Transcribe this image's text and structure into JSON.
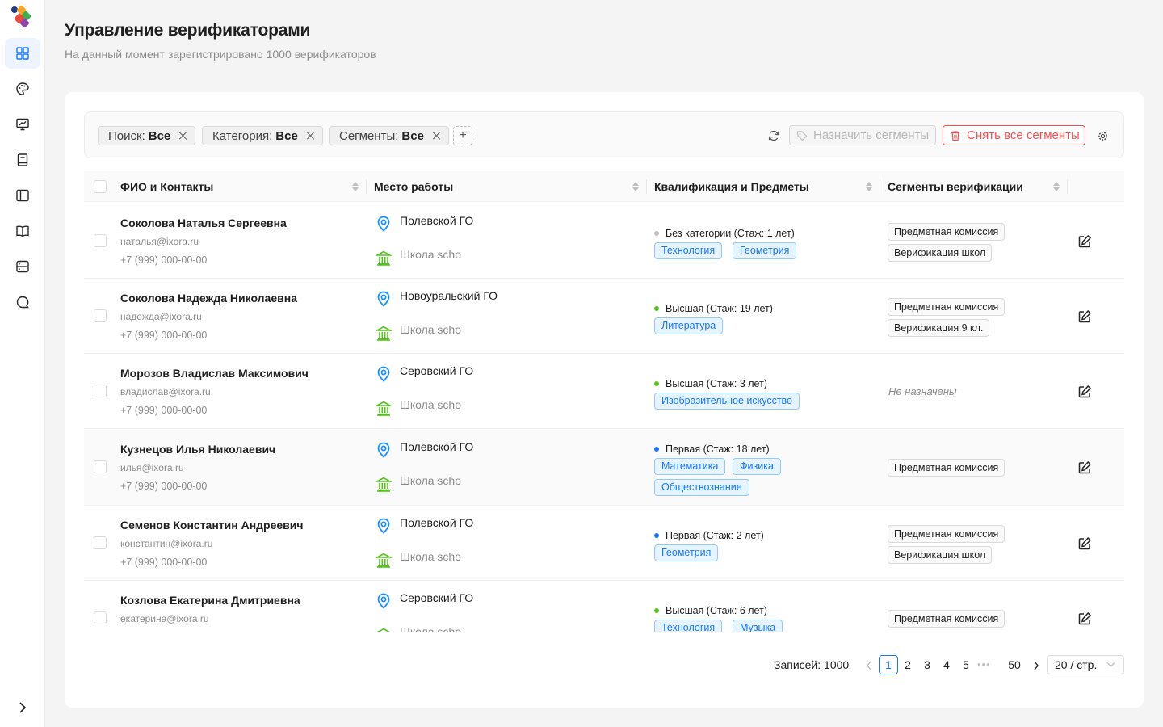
{
  "header": {
    "title": "Управление верификаторами",
    "subtitle": "На данный момент зарегистрировано 1000 верификаторов"
  },
  "sidebar": {
    "items": [
      {
        "icon": "dashboard-icon",
        "active": true
      },
      {
        "icon": "palette-icon",
        "active": false
      },
      {
        "icon": "presentation-icon",
        "active": false
      },
      {
        "icon": "book-icon",
        "active": false
      },
      {
        "icon": "sidebar-layout-icon",
        "active": false
      },
      {
        "icon": "open-book-icon",
        "active": false
      },
      {
        "icon": "server-icon",
        "active": false
      },
      {
        "icon": "chat-icon",
        "active": false
      }
    ],
    "collapse_icon": "chevron-right-icon"
  },
  "filters": {
    "chips": [
      {
        "label": "Поиск:",
        "value": "Все"
      },
      {
        "label": "Категория:",
        "value": "Все"
      },
      {
        "label": "Сегменты:",
        "value": "Все"
      }
    ],
    "add_label": "+",
    "assign_label": "Назначить сегменты",
    "remove_label": "Снять все сегменты"
  },
  "table": {
    "columns": [
      "ФИО и Контакты",
      "Место работы",
      "Квалификация и Предметы",
      "Сегменты верификации"
    ],
    "rows": [
      {
        "name": "Соколова Наталья Сергеевна",
        "email": "наталья@ixora.ru",
        "phone": "+7 (999) 000-00-00",
        "district": "Полевской ГО",
        "school": "Школа scho",
        "qualification": "Без категории (Стаж: 1 лет)",
        "qual_color": "#bfbfbf",
        "subjects": [
          "Технология",
          "Геометрия"
        ],
        "segments": [
          "Предметная комиссия",
          "Верификация школ"
        ],
        "segments_empty": ""
      },
      {
        "name": "Соколова Надежда Николаевна",
        "email": "надежда@ixora.ru",
        "phone": "+7 (999) 000-00-00",
        "district": "Новоуральский ГО",
        "school": "Школа scho",
        "qualification": "Высшая (Стаж: 19 лет)",
        "qual_color": "#52c41a",
        "subjects": [
          "Литература"
        ],
        "segments": [
          "Предметная комиссия",
          "Верификация 9 кл."
        ],
        "segments_empty": ""
      },
      {
        "name": "Морозов Владислав Максимович",
        "email": "владислав@ixora.ru",
        "phone": "+7 (999) 000-00-00",
        "district": "Серовский ГО",
        "school": "Школа scho",
        "qualification": "Высшая (Стаж: 3 лет)",
        "qual_color": "#52c41a",
        "subjects": [
          "Изобразительное искусство"
        ],
        "segments": [],
        "segments_empty": "Не назначены"
      },
      {
        "name": "Кузнецов Илья Николаевич",
        "email": "илья@ixora.ru",
        "phone": "+7 (999) 000-00-00",
        "district": "Полевской ГО",
        "school": "Школа scho",
        "qualification": "Первая (Стаж: 18 лет)",
        "qual_color": "#1677ff",
        "subjects": [
          "Математика",
          "Физика",
          "Обществознание"
        ],
        "segments": [
          "Предметная комиссия"
        ],
        "segments_empty": ""
      },
      {
        "name": "Семенов Константин Андреевич",
        "email": "константин@ixora.ru",
        "phone": "+7 (999) 000-00-00",
        "district": "Полевской ГО",
        "school": "Школа scho",
        "qualification": "Первая (Стаж: 2 лет)",
        "qual_color": "#1677ff",
        "subjects": [
          "Геометрия"
        ],
        "segments": [
          "Предметная комиссия",
          "Верификация школ"
        ],
        "segments_empty": ""
      },
      {
        "name": "Козлова Екатерина Дмитриевна",
        "email": "екатерина@ixora.ru",
        "phone": "",
        "district": "Серовский ГО",
        "school": "Школа scho",
        "qualification": "Высшая (Стаж: 6 лет)",
        "qual_color": "#52c41a",
        "subjects": [
          "Технология",
          "Музыка"
        ],
        "segments": [
          "Предметная комиссия"
        ],
        "segments_empty": ""
      }
    ]
  },
  "pagination": {
    "total_label": "Записей: 1000",
    "pages": [
      "1",
      "2",
      "3",
      "4",
      "5"
    ],
    "current": "1",
    "dots": "•••",
    "last": "50",
    "page_size": "20 / стр."
  },
  "colors": {
    "accent": "#1677ff",
    "danger": "#ff4d4f",
    "location": "#1890ff",
    "school": "#52c41a"
  }
}
